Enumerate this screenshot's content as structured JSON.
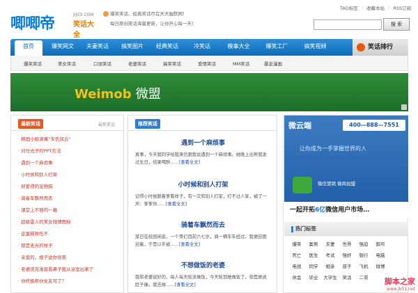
{
  "header": {
    "logo_main": "唧唧帝",
    "logo_domain": "JIJIDI.COM",
    "logo_sub": "笑话大全",
    "slogan_line1": "爆笑笑话、经典笑话尽在天天幽默网！",
    "slogan_line2": "每日原创笑话海量更新，让你开心每一天！",
    "toplinks": [
      "TAG标签",
      "收藏本站",
      "RSS订阅"
    ],
    "search_placeholder": "",
    "search_button": "搜 索"
  },
  "nav": {
    "items": [
      "首页",
      "爆笑网文",
      "夫妻笑话",
      "搞笑图片",
      "经典笑话",
      "冷笑话",
      "糗事大全",
      "爆笑工厂",
      "搞笑视频"
    ],
    "rank_label": "笑话排行"
  },
  "subnav": {
    "items": [
      "爆笑笑话",
      "美女笑话",
      "口误笑话",
      "老婆笑话",
      "搞笑笑话",
      "爱情笑话",
      "MM笑话",
      "暴走漫画"
    ]
  },
  "banner": {
    "brand_a": "Weimob",
    "brand_b": "微盟"
  },
  "left": {
    "title": "最新笑话",
    "more": "最新笑话",
    "items": [
      "韩国小姐满嘴“宋氏风云”",
      "对付光子的PPT方法",
      "遇到一个麻烦事",
      "小时候和别人打架",
      "好爱得的宠物狗",
      "骑着车飘然而去",
      "课堂上不够的一幕",
      "超级雷人的美女微博图标",
      "这蛋糕败吃不",
      "那是无光的样子",
      "亲爱的，嫂子说你很美",
      "老婆洗完澡竟看鼻子我从浴室出来了",
      "你终极帮你女友可了？"
    ]
  },
  "mid": {
    "title": "推荐笑话",
    "readmore": "[查看全文]",
    "jokes": [
      {
        "title": "遇到一个麻烦事",
        "body": "真事，今天我同学给我来信跟我说遇到一个麻烦事。她晚上出帮我发过生日，结果喝醉……"
      },
      {
        "title": "小时候和别人打架",
        "body": "记得小时候跟着爹看样子，有一次和别人打架，打不过人家，被了一声：爹爹你……"
      },
      {
        "title": "骑着车飘然而去",
        "body": "某日在校园闲逛，一个哥们目前六七岁，骑一辆车车经过，我便迎面迎着，于是以手被……"
      },
      {
        "title": "不想做饭的老婆",
        "body": "我和老婆说好的，每人每天轮流做饭，今天轮到她做饭了，但是她说肚子痛，我去做……"
      }
    ]
  },
  "right": {
    "ad_brand": "微云端",
    "ad_phone": "400—888—7551",
    "ad_tag1": "让你成为一手掌握世界的人",
    "ad_wechat": "微信营销 微商加盟",
    "ad_tagline_a": "一起开拓",
    "ad_tagline_num": "6亿",
    "ad_tagline_b": "微信用户市场…",
    "hot_title": "热门标签",
    "tags": [
      "爆笑",
      "案例",
      "夫妻",
      "世界",
      "强迫",
      "銷可",
      "死亡",
      "医生",
      "考试",
      "强奸",
      "银行",
      "电脑",
      "电视",
      "同学",
      "相亲",
      "孩子",
      "飞机",
      "微博",
      "休会",
      "毕业",
      "大学生",
      "笑话",
      "二哥",
      ""
    ]
  },
  "watermark": {
    "text": "脚本之家",
    "url": "www.jb51.net"
  }
}
